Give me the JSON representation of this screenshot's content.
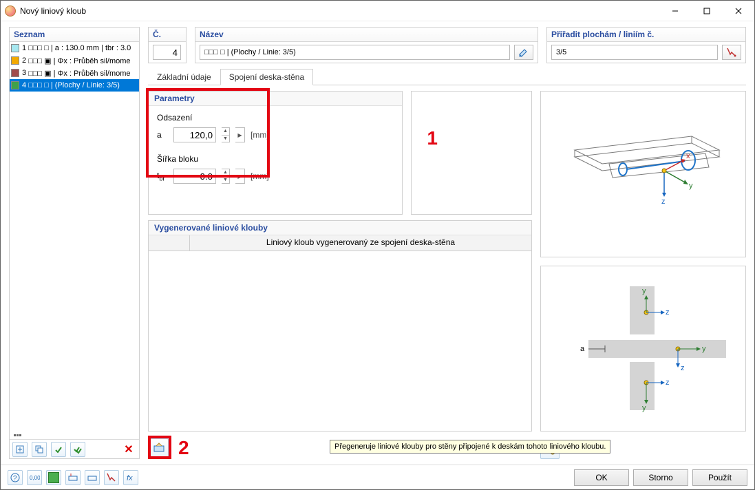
{
  "window": {
    "title": "Nový liniový kloub"
  },
  "left": {
    "header": "Seznam",
    "items": [
      {
        "idx": "1",
        "color": "#a7e8f0",
        "text": "□□□ □ | a : 130.0 mm | tbr : 3.0"
      },
      {
        "idx": "2",
        "color": "#f2a900",
        "text": "□□□ ▣ | Φx : Průběh sil/mome"
      },
      {
        "idx": "3",
        "color": "#a14b4b",
        "text": "□□□ ▣ | Φx : Průběh sil/mome"
      },
      {
        "idx": "4",
        "color": "#3fa24a",
        "text": "□□□ □ | (Plochy / Linie: 3/5)"
      }
    ],
    "footer_dots": "..."
  },
  "header": {
    "c_label": "Č.",
    "c_value": "4",
    "name_label": "Název",
    "name_value": "□□□ □ | (Plochy / Linie: 3/5)",
    "assign_label": "Přiřadit plochám / liniím č.",
    "assign_value": "3/5"
  },
  "tabs": {
    "basic": "Základní údaje",
    "joint": "Spojení deska-stěna"
  },
  "params": {
    "header": "Parametry",
    "offset_label": "Odsazení",
    "a_label": "a",
    "a_value": "120,0",
    "a_unit": "[mm]",
    "width_label": "Šířka bloku",
    "tbr_label": "tbr",
    "tbr_value": "0.0",
    "tbr_unit": "[mm]",
    "annot_1": "1"
  },
  "gen": {
    "header": "Vygenerované liniové klouby",
    "col": "Liniový kloub vygenerovaný ze spojení deska-stěna"
  },
  "annot_2": "2",
  "tooltip": "Přegeneruje liniové klouby pro stěny připojené k deskám tohoto liniového kloubu.",
  "footer": {
    "ok": "OK",
    "cancel": "Storno",
    "apply": "Použít"
  },
  "preview": {
    "axis_x": "x",
    "axis_y": "y",
    "axis_z": "z",
    "label_a": "a"
  }
}
